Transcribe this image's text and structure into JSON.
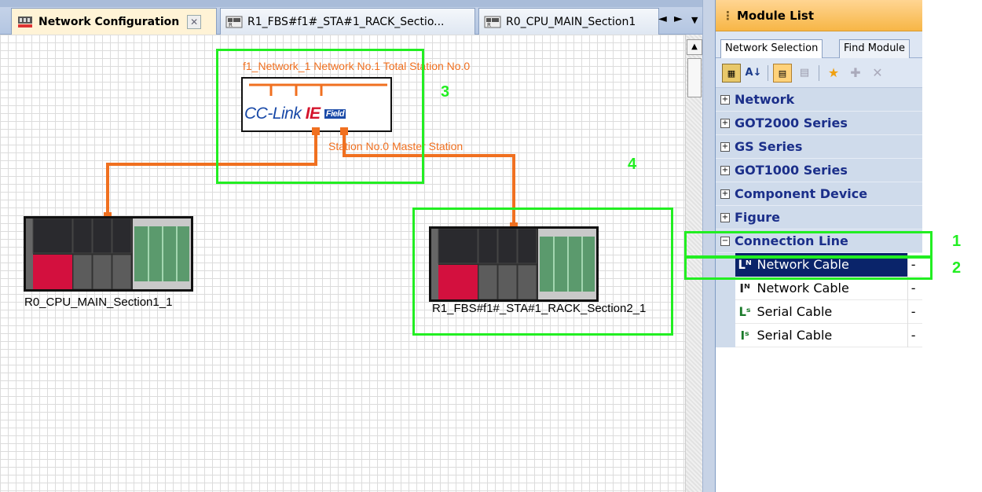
{
  "tabs": [
    {
      "label": "Network Configuration",
      "icon": "network-config-icon",
      "active": true
    },
    {
      "label": "R1_FBS#f1#_STA#1_RACK_Sectio...",
      "icon": "rack-icon"
    },
    {
      "label": "R0_CPU_MAIN_Section1",
      "icon": "rack-icon"
    }
  ],
  "tab_controls": {
    "prev": "◄",
    "next": "►",
    "menu": "▼"
  },
  "diagram": {
    "network_label": "f1_Network_1  Network No.1  Total Station No.0",
    "cclink_text": "CC-Link",
    "cclink_ie": "IE",
    "cclink_field": "Field",
    "station_label": "Station No.0  Master Station",
    "rack_left_label": "R0_CPU_MAIN_Section1_1",
    "rack_right_label": "R1_FBS#f1#_STA#1_RACK_Section2_1"
  },
  "callouts": {
    "c1": "1",
    "c2": "2",
    "c3": "3",
    "c4": "4"
  },
  "module_list": {
    "title": "Module List",
    "tabs": [
      "Network Selection",
      "Find Module"
    ],
    "groups": [
      {
        "label": "Network",
        "expanded": false
      },
      {
        "label": "GOT2000 Series",
        "expanded": false
      },
      {
        "label": "GS Series",
        "expanded": false
      },
      {
        "label": "GOT1000 Series",
        "expanded": false
      },
      {
        "label": "Component Device",
        "expanded": false
      },
      {
        "label": "Figure",
        "expanded": false
      },
      {
        "label": "Connection Line",
        "expanded": true
      }
    ],
    "items": [
      {
        "icon": "network-cable-icon",
        "label": "Network Cable",
        "value": "-",
        "selected": true
      },
      {
        "icon": "network-cable-straight-icon",
        "label": "Network Cable",
        "value": "-"
      },
      {
        "icon": "serial-cable-icon",
        "label": "Serial Cable",
        "value": "-"
      },
      {
        "icon": "serial-cable-straight-icon",
        "label": "Serial Cable",
        "value": "-"
      }
    ]
  },
  "colors": {
    "accent_orange": "#f07020",
    "highlight_green": "#22ee22",
    "selection": "#0a246a"
  }
}
